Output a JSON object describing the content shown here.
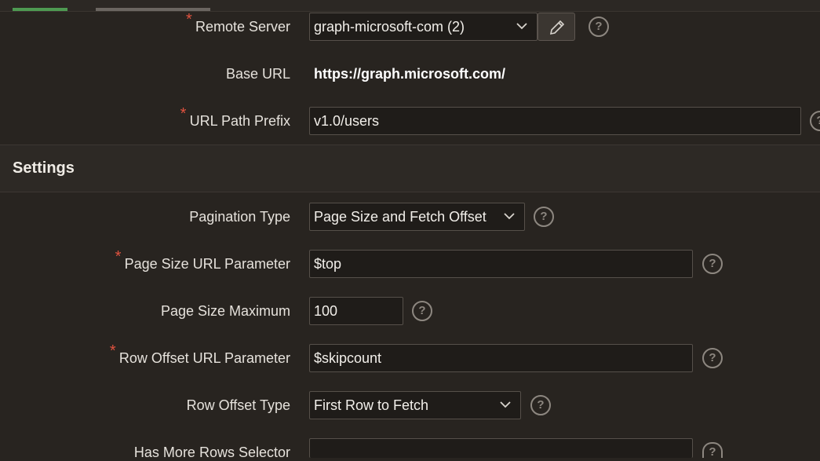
{
  "colors": {
    "background": "#282420",
    "section_bg": "#2d2925",
    "required": "#e0523f",
    "tab_active": "#4e9a52",
    "tab_inactive": "#6b6661"
  },
  "icons": {
    "help": "help-icon",
    "edit": "pencil-icon",
    "dropdown": "chevron-down-icon"
  },
  "remote_server": {
    "required_mark": "*",
    "label": "Remote Server",
    "value": "graph-microsoft-com (2)"
  },
  "base_url": {
    "label": "Base URL",
    "value": "https://graph.microsoft.com/"
  },
  "url_path_prefix": {
    "required_mark": "*",
    "label": "URL Path Prefix",
    "value": "v1.0/users"
  },
  "settings": {
    "title": "Settings",
    "pagination_type": {
      "label": "Pagination Type",
      "value": "Page Size and Fetch Offset"
    },
    "page_size_param": {
      "required_mark": "*",
      "label": "Page Size URL Parameter",
      "value": "$top"
    },
    "page_size_max": {
      "label": "Page Size Maximum",
      "value": "100"
    },
    "row_offset_param": {
      "required_mark": "*",
      "label": "Row Offset URL Parameter",
      "value": "$skipcount"
    },
    "row_offset_type": {
      "label": "Row Offset Type",
      "value": "First Row to Fetch"
    },
    "has_more_rows": {
      "label": "Has More Rows Selector",
      "value": ""
    }
  },
  "help_glyph": "?"
}
